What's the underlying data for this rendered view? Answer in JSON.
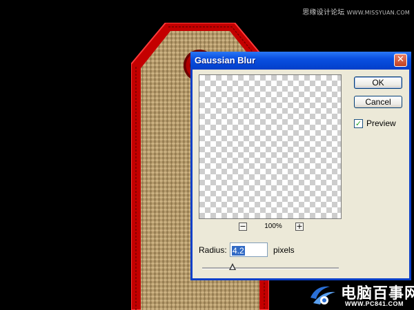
{
  "watermark": {
    "top_cn": "思缘设计论坛",
    "top_en": "WWW.MISSYUAN.COM",
    "brand": "电脑百事网",
    "url": "WWW.PC841.COM"
  },
  "dialog": {
    "title": "Gaussian Blur",
    "close_glyph": "✕",
    "ok_label": "OK",
    "cancel_label": "Cancel",
    "preview_label": "Preview",
    "preview_checked": true,
    "check_glyph": "✓",
    "zoom_out_glyph": "−",
    "zoom_in_glyph": "+",
    "zoom_level": "100%",
    "radius_label": "Radius:",
    "radius_value": "4.2",
    "radius_units": "pixels",
    "radius_slider_fraction": 0.22
  },
  "colors": {
    "titlebar": "#0a4fe0",
    "dialog_bg": "#ece9d8",
    "tag_red": "#c40000",
    "burlap": "#b59a6c"
  },
  "icons": [
    "close-icon",
    "zoom-out-icon",
    "zoom-in-icon",
    "checkmark-icon",
    "slider-thumb-icon",
    "pc841-logo-icon"
  ]
}
